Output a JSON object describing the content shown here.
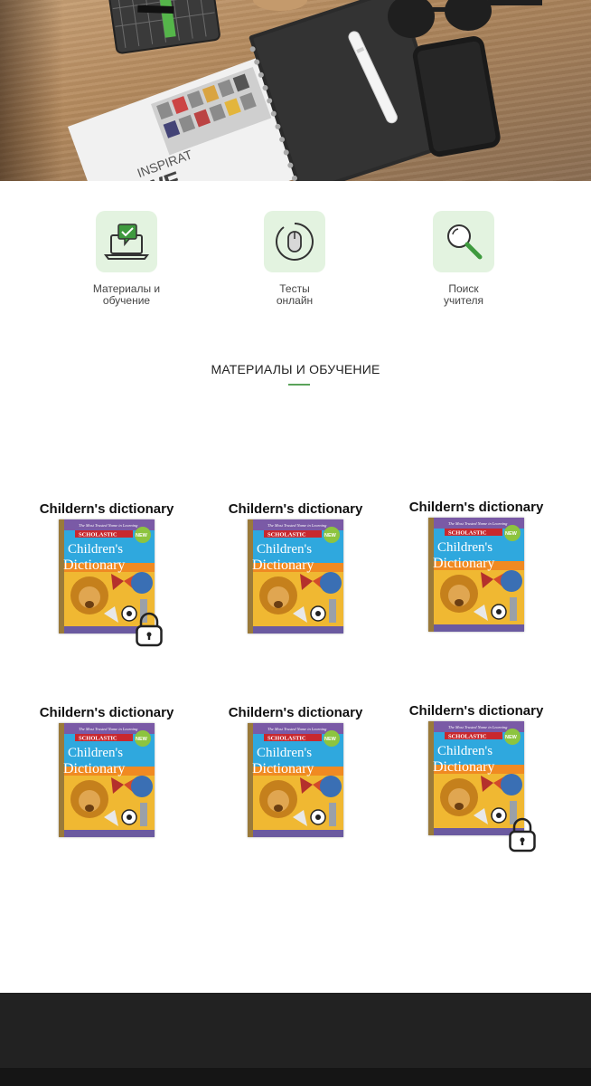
{
  "features": [
    {
      "label": "Материалы и\nобучение",
      "icon": "laptop-check-icon"
    },
    {
      "label": "Тесты\nонлайн",
      "icon": "mouse-icon"
    },
    {
      "label": "Поиск\nучителя",
      "icon": "magnifier-icon"
    }
  ],
  "section": {
    "title": "МАТЕРИАЛЫ И ОБУЧЕНИЕ",
    "accent_color": "#5aa35a"
  },
  "books": [
    {
      "title": "Childern's dictionary",
      "locked": true
    },
    {
      "title": "Childern's dictionary",
      "locked": false
    },
    {
      "title": "Childern's dictionary",
      "locked": false
    },
    {
      "title": "Childern's dictionary",
      "locked": false
    },
    {
      "title": "Childern's dictionary",
      "locked": false
    },
    {
      "title": "Childern's dictionary",
      "locked": true
    }
  ],
  "book_cover": {
    "tagline": "The Most Trusted Name in Learning",
    "publisher": "SCHOLASTIC",
    "title_line1": "Children's",
    "title_line2": "Dictionary",
    "badge": "NEW"
  },
  "hero": {
    "magazine_text_1": "INSPIRAT",
    "magazine_text_2": "WE"
  }
}
